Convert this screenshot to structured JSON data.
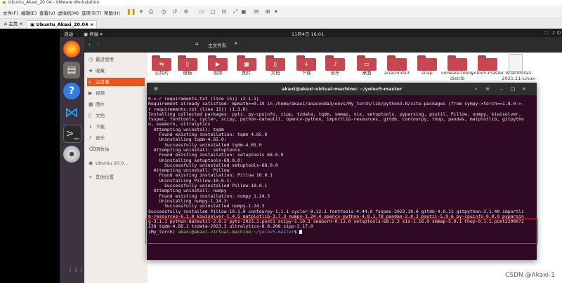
{
  "window": {
    "title": "Ubuntu_Akaxi_20.04 - VMware Workstation",
    "menus": [
      "文件(F)",
      "编辑(E)",
      "查看(V)",
      "虚拟机(M)",
      "选项卡(T)",
      "帮助(H)"
    ],
    "tabs": [
      {
        "label": "主页"
      },
      {
        "label": "Ubuntu_Akaxi_20.04"
      }
    ]
  },
  "topbar": {
    "activities": "活动",
    "app": "终端",
    "clock": "11月4日 16:01"
  },
  "files": {
    "location": "主文件夹",
    "sidebar": [
      {
        "label": "最近使用",
        "icon": "clock-icon"
      },
      {
        "label": "收藏",
        "icon": "star-icon"
      },
      {
        "label": "主目录",
        "icon": "home-icon"
      },
      {
        "label": "视频",
        "icon": "video-icon"
      },
      {
        "label": "图片",
        "icon": "picture-icon"
      },
      {
        "label": "文档",
        "icon": "document-icon"
      },
      {
        "label": "下载",
        "icon": "download-icon"
      },
      {
        "label": "音乐",
        "icon": "music-icon"
      },
      {
        "label": "回收站",
        "icon": "trash-icon"
      },
      {
        "label": "Ubuntu 20.0...",
        "icon": "disc-icon"
      },
      {
        "label": "其他位置",
        "icon": "plus-icon"
      }
    ],
    "folders": [
      {
        "label": "公共的"
      },
      {
        "label": "模板"
      },
      {
        "label": "视频"
      },
      {
        "label": "图片"
      },
      {
        "label": "文档"
      },
      {
        "label": "下载"
      },
      {
        "label": "音乐"
      },
      {
        "label": "桌面"
      },
      {
        "label": "anaconda3"
      },
      {
        "label": "snap"
      },
      {
        "label": "vmware-tools-distrib"
      },
      {
        "label": "yolov5-master"
      },
      {
        "label": "Anaconda3-2021.11-Linux-x86..."
      }
    ]
  },
  "terminal": {
    "title": "akaxi@akaxi-virtual-machine: ~/yolov5-master",
    "lines": [
      "0->-r requirements.txt (line 15)) (2.1.1)",
      "Requirement already satisfied: mpmath>=0.19 in /home/akaxi/anaconda3/envs/My_torch/lib/python3.8/site-packages (from sympy->torch>=1.8.0->-",
      "r requirements.txt (line 15)) (1.3.0)",
      "Installing collected packages: pytz, py-cpuinfo, zipp, tzdata, tqdm, smmap, six, setuptools, pyparsing, psutil, Pillow, numpy, kiwisolver,",
      "fsspec, fonttools, cycler, scipy, python-dateutil, opencv-python, importlib-resources, gitdb, contourpy, thop, pandas, matplotlib, gitpytho",
      "n, seaborn, ultralytics",
      "  Attempting uninstall: tqdm",
      "    Found existing installation: tqdm 4.65.0",
      "    Uninstalling tqdm-4.65.0:",
      "      Successfully uninstalled tqdm-4.65.0",
      "  Attempting uninstall: setuptools",
      "    Found existing installation: setuptools 68.0.0",
      "    Uninstalling setuptools-68.0.0:",
      "      Successfully uninstalled setuptools-68.0.0",
      "  Attempting uninstall: Pillow",
      "    Found existing installation: Pillow 10.0.1",
      "    Uninstalling Pillow-10.0.1:",
      "      Successfully uninstalled Pillow-10.0.1",
      "  Attempting uninstall: numpy",
      "    Found existing installation: numpy 1.24.3",
      "    Uninstalling numpy-1.24.3:",
      "      Successfully uninstalled numpy-1.24.3",
      "Successfully installed Pillow-10.1.0 contourpy-1.1.1 cycler-0.12.1 fonttools-4.44.0 fsspec-2023.10.0 gitdb-4.0.11 gitpython-3.1.40 importli",
      "b-resources-6.1.0 kiwisolver-1.4.5 matplotlib-3.7.3 numpy-1.24.4 opencv-python-4.8.1.78 pandas-2.0.3 psutil-5.9.6 py-cpuinfo-9.0.0 pyparsin",
      "g-3.1.1 python-dateutil-2.8.2 pytz-2023.3.post1 scipy-1.10.1 seaborn-0.13.0 setuptools-68.2.2 six-1.16.0 smmap-5.0.1 thop-0.1.1.post2209072",
      "238 tqdm-4.66.1 tzdata-2023.3 ultralytics-8.0.208 zipp-3.17.0"
    ],
    "prompt_env": "(My_torch) ",
    "prompt_user": "akaxi@akaxi-virtual-machine",
    "prompt_path": ":~/yolov5-master",
    "prompt_end": "$ "
  },
  "watermark": "CSDN @Akaxi-1"
}
